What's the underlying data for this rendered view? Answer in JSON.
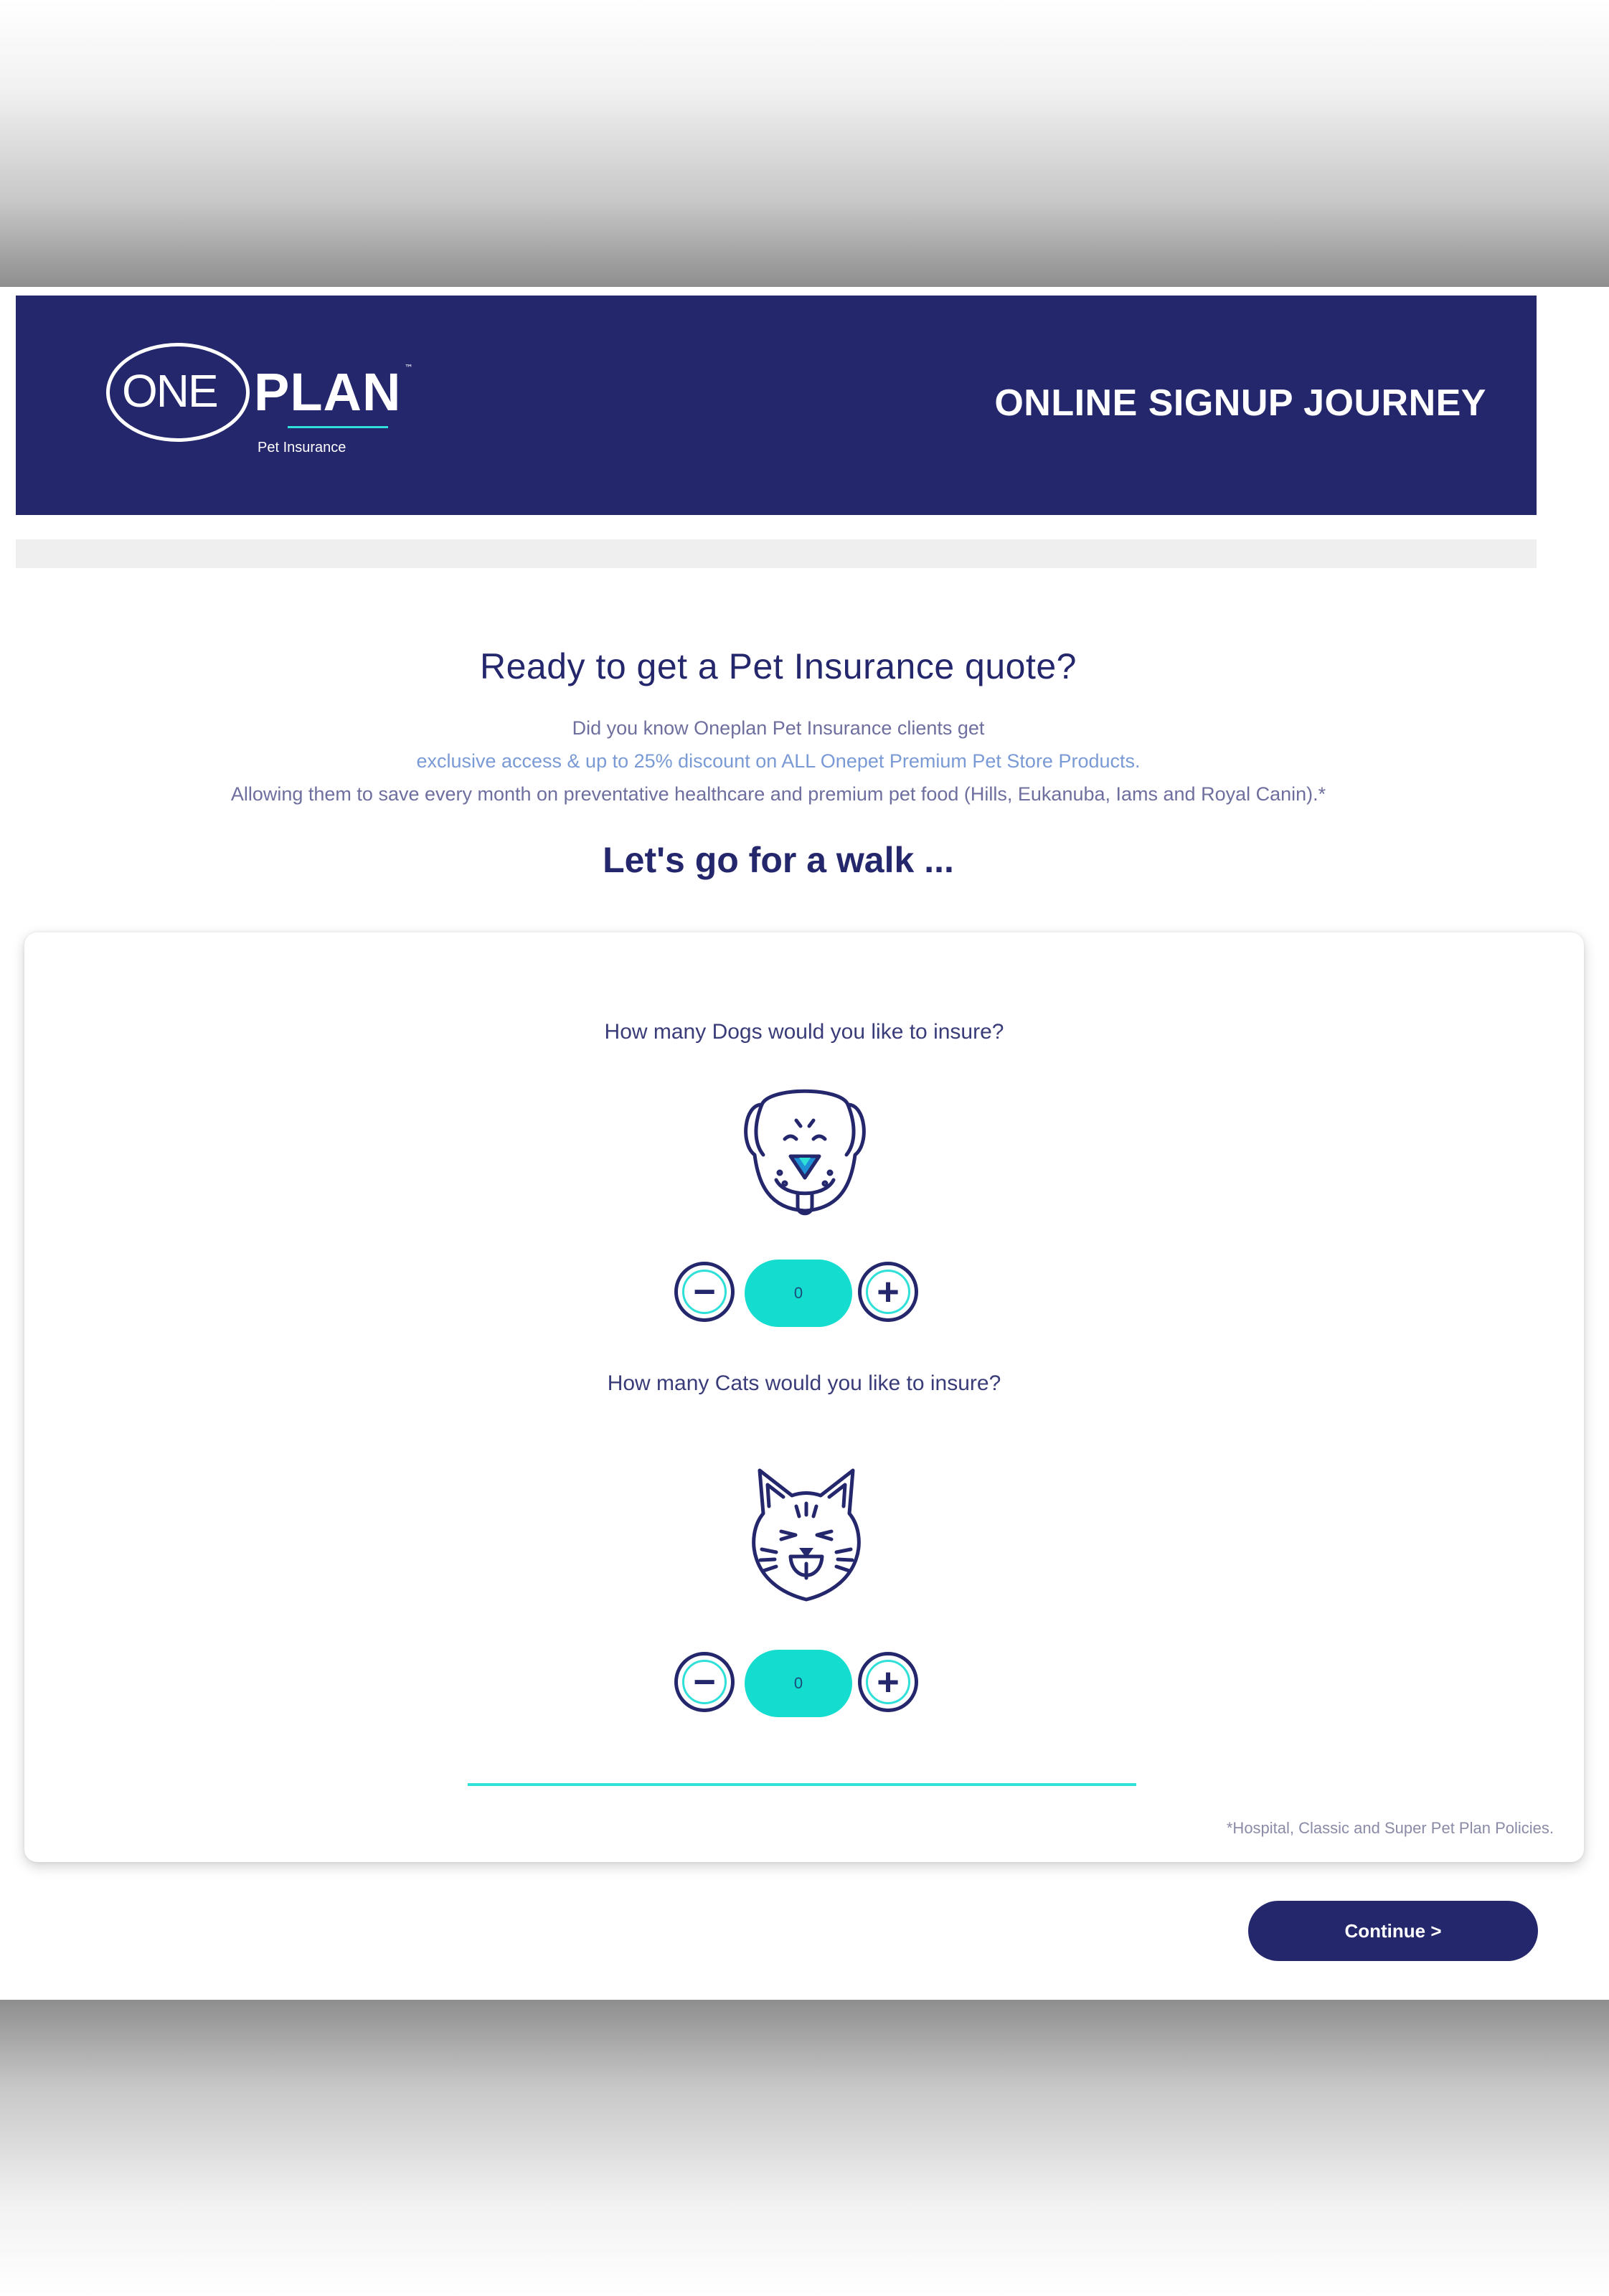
{
  "brand": {
    "logo_one": "ONE",
    "logo_plan": "PLAN",
    "logo_tm": "™",
    "logo_sub": "Pet Insurance",
    "primary_color": "#25276d",
    "accent_color": "#14dccf"
  },
  "header": {
    "title": "ONLINE SIGNUP JOURNEY"
  },
  "main": {
    "heading": "Ready to get a Pet Insurance quote?",
    "intro_line_1": "Did you know Oneplan Pet Insurance clients get",
    "intro_line_2": "exclusive access & up to 25% discount on ALL Onepet Premium Pet Store Products.",
    "intro_line_3": "Allowing them to save every month on preventative healthcare and premium pet food (Hills, Eukanuba, Iams and Royal Canin).*",
    "subheading": "Let's go for a walk ..."
  },
  "dogs": {
    "question": "How many Dogs would you like to insure?",
    "icon": "dog-face-icon",
    "minus": "−",
    "plus": "+",
    "count": "0"
  },
  "cats": {
    "question": "How many Cats would you like to insure?",
    "icon": "cat-face-icon",
    "minus": "−",
    "plus": "+",
    "count": "0"
  },
  "footnote": "*Hospital, Classic and Super Pet Plan Policies.",
  "continue_label": "Continue >"
}
